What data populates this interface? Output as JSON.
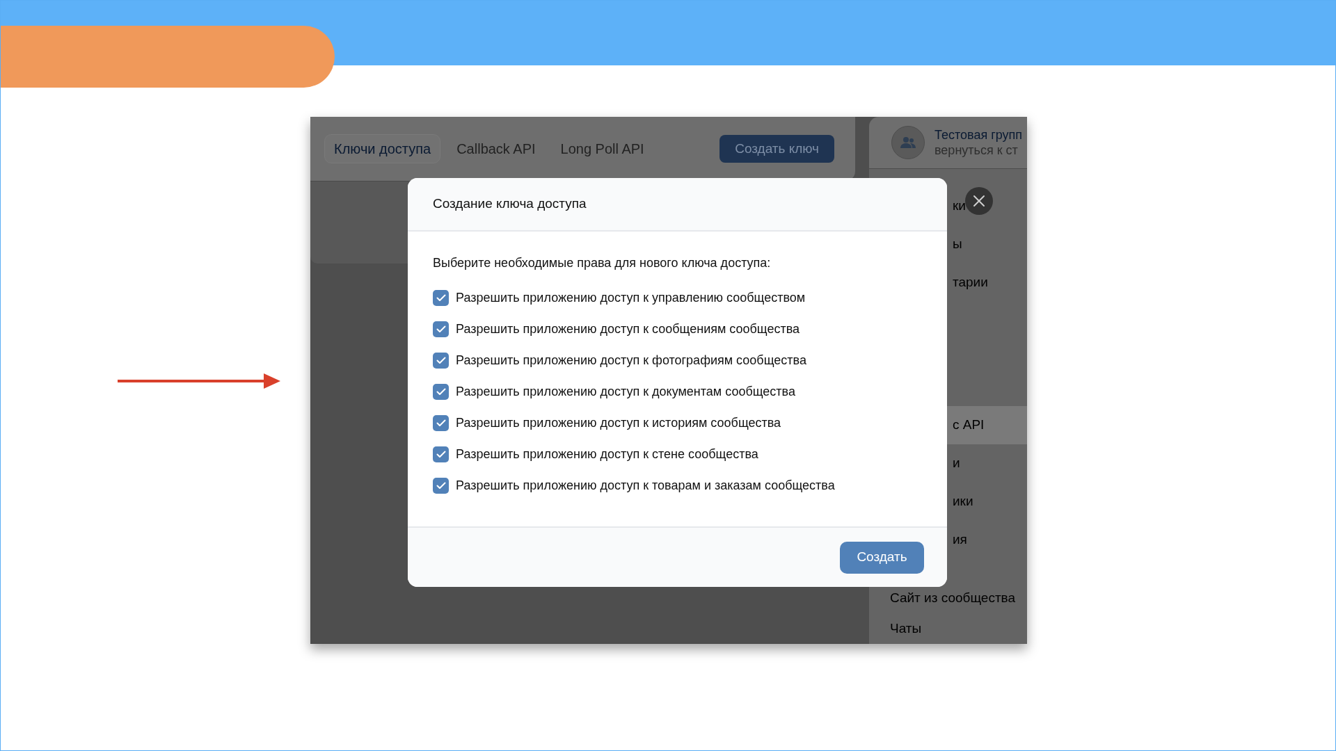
{
  "tabs": [
    {
      "label": "Ключи доступа",
      "selected": true
    },
    {
      "label": "Callback API",
      "selected": false
    },
    {
      "label": "Long Poll API",
      "selected": false
    }
  ],
  "create_key_button": "Создать ключ",
  "community": {
    "name": "Тестовая групп",
    "link": "вернуться к ст"
  },
  "sidebar": {
    "items": [
      {
        "label": "ки",
        "kind": "partial",
        "selected": false
      },
      {
        "label": "ы",
        "kind": "partial",
        "selected": false
      },
      {
        "label": "тарии",
        "kind": "partial",
        "selected": false
      },
      {
        "label": "с API",
        "kind": "partial",
        "selected": true
      },
      {
        "label": "и",
        "kind": "partial",
        "selected": false
      },
      {
        "label": "ики",
        "kind": "partial",
        "selected": false
      },
      {
        "label": "ия",
        "kind": "partial",
        "selected": false
      },
      {
        "label": "Сайт из сообщества",
        "kind": "full",
        "selected": false
      },
      {
        "label": "Чаты",
        "kind": "full",
        "selected": false
      }
    ]
  },
  "dialog": {
    "title": "Создание ключа доступа",
    "prompt": "Выберите необходимые права для нового ключа доступа:",
    "options": [
      {
        "label": "Разрешить приложению доступ к управлению сообществом",
        "checked": true
      },
      {
        "label": "Разрешить приложению доступ к сообщениям сообщества",
        "checked": true
      },
      {
        "label": "Разрешить приложению доступ к фотографиям сообщества",
        "checked": true
      },
      {
        "label": "Разрешить приложению доступ к документам сообщества",
        "checked": true
      },
      {
        "label": "Разрешить приложению доступ к историям сообщества",
        "checked": true
      },
      {
        "label": "Разрешить приложению доступ к стене сообщества",
        "checked": true
      },
      {
        "label": "Разрешить приложению доступ к товарам и заказам сообщества",
        "checked": true
      }
    ],
    "submit": "Создать"
  }
}
